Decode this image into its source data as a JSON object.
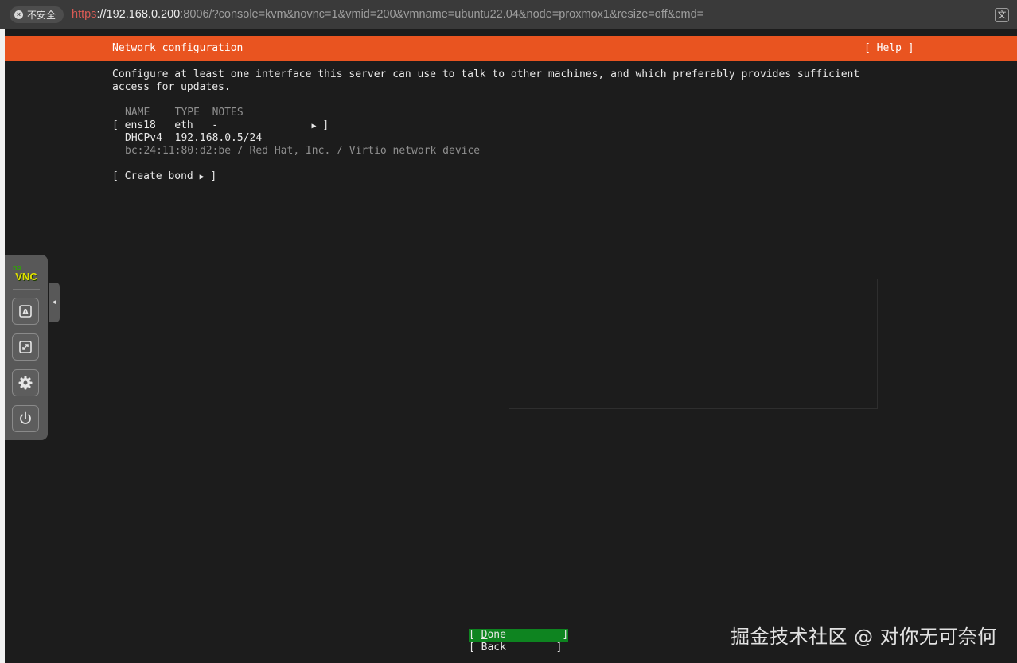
{
  "browser": {
    "security_label": "不安全",
    "url_scheme": "https",
    "url_host": "://192.168.0.200",
    "url_rest": ":8006/?console=kvm&novnc=1&vmid=200&vmname=ubuntu22.04&node=proxmox1&resize=off&cmd=",
    "translate_icon": "translate-icon"
  },
  "installer": {
    "header_title": "Network configuration",
    "help_label": "[ Help ]",
    "intro_line1": "Configure at least one interface this server can use to talk to other machines, and which preferably provides sufficient",
    "intro_line2": "access for updates.",
    "table_header": "NAME    TYPE  NOTES",
    "iface_bracket_open": "[",
    "iface_row": "ens18   eth   -               ",
    "iface_arrow": "▶",
    "iface_bracket_close": " ]",
    "dhcp_row": "DHCPv4  192.168.0.5/24",
    "device_info": "bc:24:11:80:d2:be / Red Hat, Inc. / Virtio network device",
    "create_bond": "[ Create bond ",
    "create_bond_arrow": "▶",
    "create_bond_close": " ]",
    "done_open": "[ ",
    "done_key": "D",
    "done_rest": "one         ]",
    "back_label": "[ Back        ]"
  },
  "novnc": {
    "logo_no": "no",
    "logo_vnc": "VNC",
    "buttons": [
      "keyboard-icon",
      "scale-icon",
      "gear-icon",
      "power-icon"
    ]
  },
  "watermark": "掘金技术社区 @ 对你无可奈何",
  "colors": {
    "header_orange": "#e95420",
    "done_green": "#0e8420",
    "terminal_bg": "#1c1c1c"
  }
}
